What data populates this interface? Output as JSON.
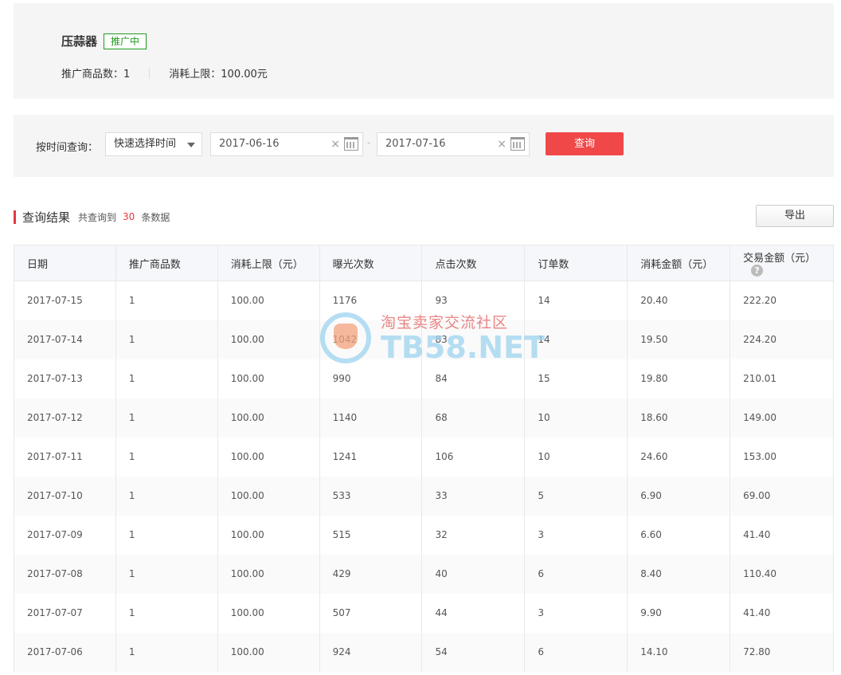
{
  "summary": {
    "name": "压蒜器",
    "status": "推广中",
    "product_count_label": "推广商品数：1",
    "budget_label": "消耗上限：100.00元"
  },
  "filter": {
    "label": "按时间查询：",
    "quick_select": "快速选择时间",
    "start_date": "2017-06-16",
    "end_date": "2017-07-16",
    "query_button": "查询",
    "separator": "-"
  },
  "results": {
    "title": "查询结果",
    "prefix": "共查询到",
    "count": "30",
    "suffix": "条数据",
    "export_button": "导出"
  },
  "table": {
    "headers": [
      "日期",
      "推广商品数",
      "消耗上限（元）",
      "曝光次数",
      "点击次数",
      "订单数",
      "消耗金额（元）",
      "交易金额（元）"
    ],
    "rows": [
      [
        "2017-07-15",
        "1",
        "100.00",
        "1176",
        "93",
        "14",
        "20.40",
        "222.20"
      ],
      [
        "2017-07-14",
        "1",
        "100.00",
        "1042",
        "83",
        "14",
        "19.50",
        "224.20"
      ],
      [
        "2017-07-13",
        "1",
        "100.00",
        "990",
        "84",
        "15",
        "19.80",
        "210.01"
      ],
      [
        "2017-07-12",
        "1",
        "100.00",
        "1140",
        "68",
        "10",
        "18.60",
        "149.00"
      ],
      [
        "2017-07-11",
        "1",
        "100.00",
        "1241",
        "106",
        "10",
        "24.60",
        "153.00"
      ],
      [
        "2017-07-10",
        "1",
        "100.00",
        "533",
        "33",
        "5",
        "6.90",
        "69.00"
      ],
      [
        "2017-07-09",
        "1",
        "100.00",
        "515",
        "32",
        "3",
        "6.60",
        "41.40"
      ],
      [
        "2017-07-08",
        "1",
        "100.00",
        "429",
        "40",
        "6",
        "8.40",
        "110.40"
      ],
      [
        "2017-07-07",
        "1",
        "100.00",
        "507",
        "44",
        "3",
        "9.90",
        "41.40"
      ],
      [
        "2017-07-06",
        "1",
        "100.00",
        "924",
        "54",
        "6",
        "14.10",
        "72.80"
      ]
    ]
  },
  "watermark": {
    "text_cn": "淘宝卖家交流社区",
    "text_en": "TB58.NET"
  }
}
